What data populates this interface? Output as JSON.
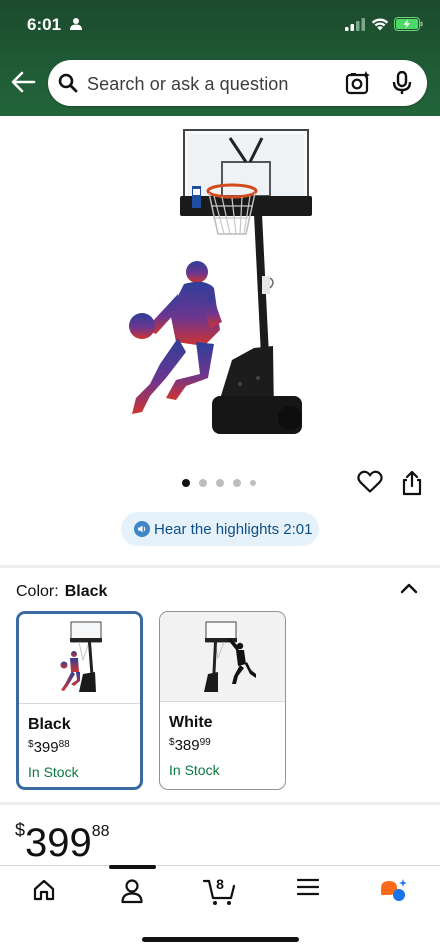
{
  "status_bar": {
    "time": "6:01"
  },
  "search": {
    "placeholder": "Search or ask a question"
  },
  "product": {
    "image_count_dots": 5,
    "active_image": 1,
    "hear_highlights": "Hear the highlights 2:01"
  },
  "color_selector": {
    "label": "Color:",
    "selected": "Black",
    "options": [
      {
        "name": "Black",
        "currency": "$",
        "price_whole": "399",
        "price_cents": "88",
        "stock": "In Stock",
        "selected": true
      },
      {
        "name": "White",
        "currency": "$",
        "price_whole": "389",
        "price_cents": "99",
        "stock": "In Stock",
        "selected": false
      }
    ]
  },
  "price": {
    "currency": "$",
    "whole": "399",
    "cents": "88"
  },
  "bottom_nav": {
    "items": [
      "home-icon",
      "account-icon",
      "cart-icon",
      "menu-icon",
      "rufus-icon"
    ],
    "cart_count": "8",
    "active": "account-icon"
  },
  "colors": {
    "header_green": "#1f5a36",
    "accent_blue": "#3a6aa0",
    "in_stock_green": "#0b7a3f",
    "pill_bg": "#e6f2fb"
  }
}
